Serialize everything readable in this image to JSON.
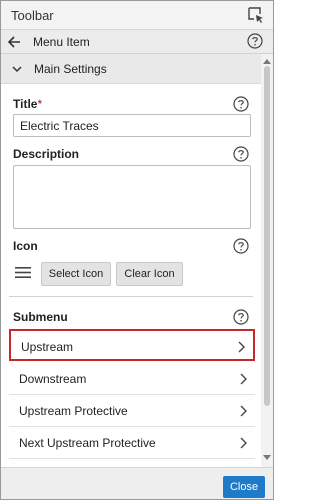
{
  "toolbar": {
    "title": "Toolbar"
  },
  "nav": {
    "title": "Menu Item"
  },
  "section": {
    "title": "Main Settings"
  },
  "fields": {
    "title_label": "Title",
    "title_required": "*",
    "title_value": "Electric Traces",
    "description_label": "Description",
    "description_value": "",
    "icon_label": "Icon",
    "select_icon": "Select Icon",
    "clear_icon": "Clear Icon",
    "submenu_label": "Submenu"
  },
  "submenu": [
    {
      "label": "Upstream",
      "selected": true
    },
    {
      "label": "Downstream",
      "selected": false
    },
    {
      "label": "Upstream Protective",
      "selected": false
    },
    {
      "label": "Next Upstream Protective",
      "selected": false
    }
  ],
  "footer": {
    "close": "Close"
  },
  "colors": {
    "accent": "#1f7ac8",
    "selection": "#c62828"
  },
  "icons": [
    "select-element-icon",
    "back-arrow-icon",
    "help-icon",
    "chevron-down-icon",
    "hamburger-icon",
    "chevron-right-icon"
  ]
}
